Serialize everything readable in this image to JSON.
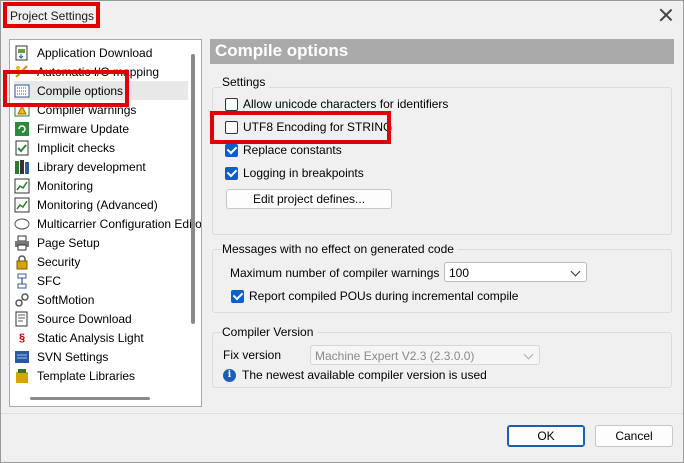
{
  "window": {
    "title": "Project Settings",
    "close_icon": "close-icon"
  },
  "sidebar": {
    "items": [
      {
        "label": "Application Download",
        "icon": "download-app-icon",
        "selected": false
      },
      {
        "label": "Automatic I/O mapping",
        "icon": "io-mapping-icon",
        "selected": false
      },
      {
        "label": "Compile options",
        "icon": "compile-options-icon",
        "selected": true
      },
      {
        "label": "Compiler warnings",
        "icon": "compiler-warnings-icon",
        "selected": false
      },
      {
        "label": "Firmware Update",
        "icon": "firmware-update-icon",
        "selected": false
      },
      {
        "label": "Implicit checks",
        "icon": "implicit-checks-icon",
        "selected": false
      },
      {
        "label": "Library development",
        "icon": "library-development-icon",
        "selected": false
      },
      {
        "label": "Monitoring",
        "icon": "monitoring-icon",
        "selected": false
      },
      {
        "label": "Monitoring (Advanced)",
        "icon": "monitoring-advanced-icon",
        "selected": false
      },
      {
        "label": "Multicarrier Configuration Edito",
        "icon": "multicarrier-icon",
        "selected": false
      },
      {
        "label": "Page Setup",
        "icon": "printer-icon",
        "selected": false
      },
      {
        "label": "Security",
        "icon": "security-icon",
        "selected": false
      },
      {
        "label": "SFC",
        "icon": "sfc-icon",
        "selected": false
      },
      {
        "label": "SoftMotion",
        "icon": "softmotion-icon",
        "selected": false
      },
      {
        "label": "Source Download",
        "icon": "source-download-icon",
        "selected": false
      },
      {
        "label": "Static Analysis Light",
        "icon": "static-analysis-icon",
        "selected": false
      },
      {
        "label": "SVN Settings",
        "icon": "svn-icon",
        "selected": false
      },
      {
        "label": "Template Libraries",
        "icon": "template-libraries-icon",
        "selected": false
      }
    ]
  },
  "panel": {
    "header": "Compile options",
    "settings": {
      "label": "Settings",
      "options": [
        {
          "label": "Allow unicode characters for identifiers",
          "checked": false
        },
        {
          "label": "UTF8 Encoding for STRING",
          "checked": false
        },
        {
          "label": "Replace constants",
          "checked": true
        },
        {
          "label": "Logging in breakpoints",
          "checked": true
        }
      ],
      "edit_defines_button": "Edit project defines..."
    },
    "messages": {
      "label": "Messages with no effect on generated code",
      "max_warnings_label": "Maximum number of compiler warnings",
      "max_warnings_value": "100",
      "report_label": "Report compiled POUs during incremental compile",
      "report_checked": true
    },
    "compiler_version": {
      "label": "Compiler Version",
      "fix_version_label": "Fix version",
      "fix_version_value": "Machine Expert V2.3 (2.3.0.0)",
      "info_text": "The newest available compiler version is used"
    }
  },
  "footer": {
    "ok_label": "OK",
    "cancel_label": "Cancel"
  },
  "colors": {
    "highlight": "#e30000",
    "header_bg": "#aaaaaa",
    "accent": "#0a5fcf"
  }
}
